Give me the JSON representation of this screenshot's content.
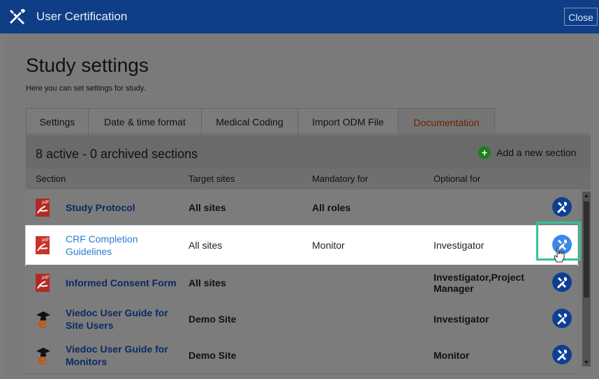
{
  "window": {
    "title": "User Certification",
    "close_label": "Close"
  },
  "page": {
    "heading": "Study settings",
    "subheading": "Here you can set settings for study."
  },
  "tabs": [
    {
      "label": "Settings"
    },
    {
      "label": "Date & time format"
    },
    {
      "label": "Medical Coding"
    },
    {
      "label": "Import ODM File"
    },
    {
      "label": "Documentation",
      "active": true
    }
  ],
  "summary": {
    "text": "8 active - 0 archived sections",
    "add_label": "Add a new section"
  },
  "columns": {
    "section": "Section",
    "target": "Target sites",
    "mandatory": "Mandatory for",
    "optional": "Optional for"
  },
  "rows": [
    {
      "icon": "pdf-icon",
      "name": "Study Protocol",
      "target": "All sites",
      "mandatory": "All roles",
      "optional": ""
    },
    {
      "icon": "pdf-icon",
      "name": "CRF Completion Guidelines",
      "target": "All sites",
      "mandatory": "Monitor",
      "optional": "Investigator"
    },
    {
      "icon": "pdf-icon",
      "name": "Informed Consent Form",
      "target": "All sites",
      "mandatory": "",
      "optional": "Investigator,Project Manager"
    },
    {
      "icon": "elearning-icon",
      "name": "Viedoc User Guide for Site Users",
      "target": "Demo Site",
      "mandatory": "",
      "optional": "Investigator"
    },
    {
      "icon": "elearning-icon",
      "name": "Viedoc User Guide for Monitors",
      "target": "Demo Site",
      "mandatory": "",
      "optional": "Monitor"
    }
  ],
  "colors": {
    "header": "#0f3d86",
    "active_tab": "#6a2300",
    "tool_button": "#0d3f93",
    "highlight_focus": "#34c29c"
  }
}
